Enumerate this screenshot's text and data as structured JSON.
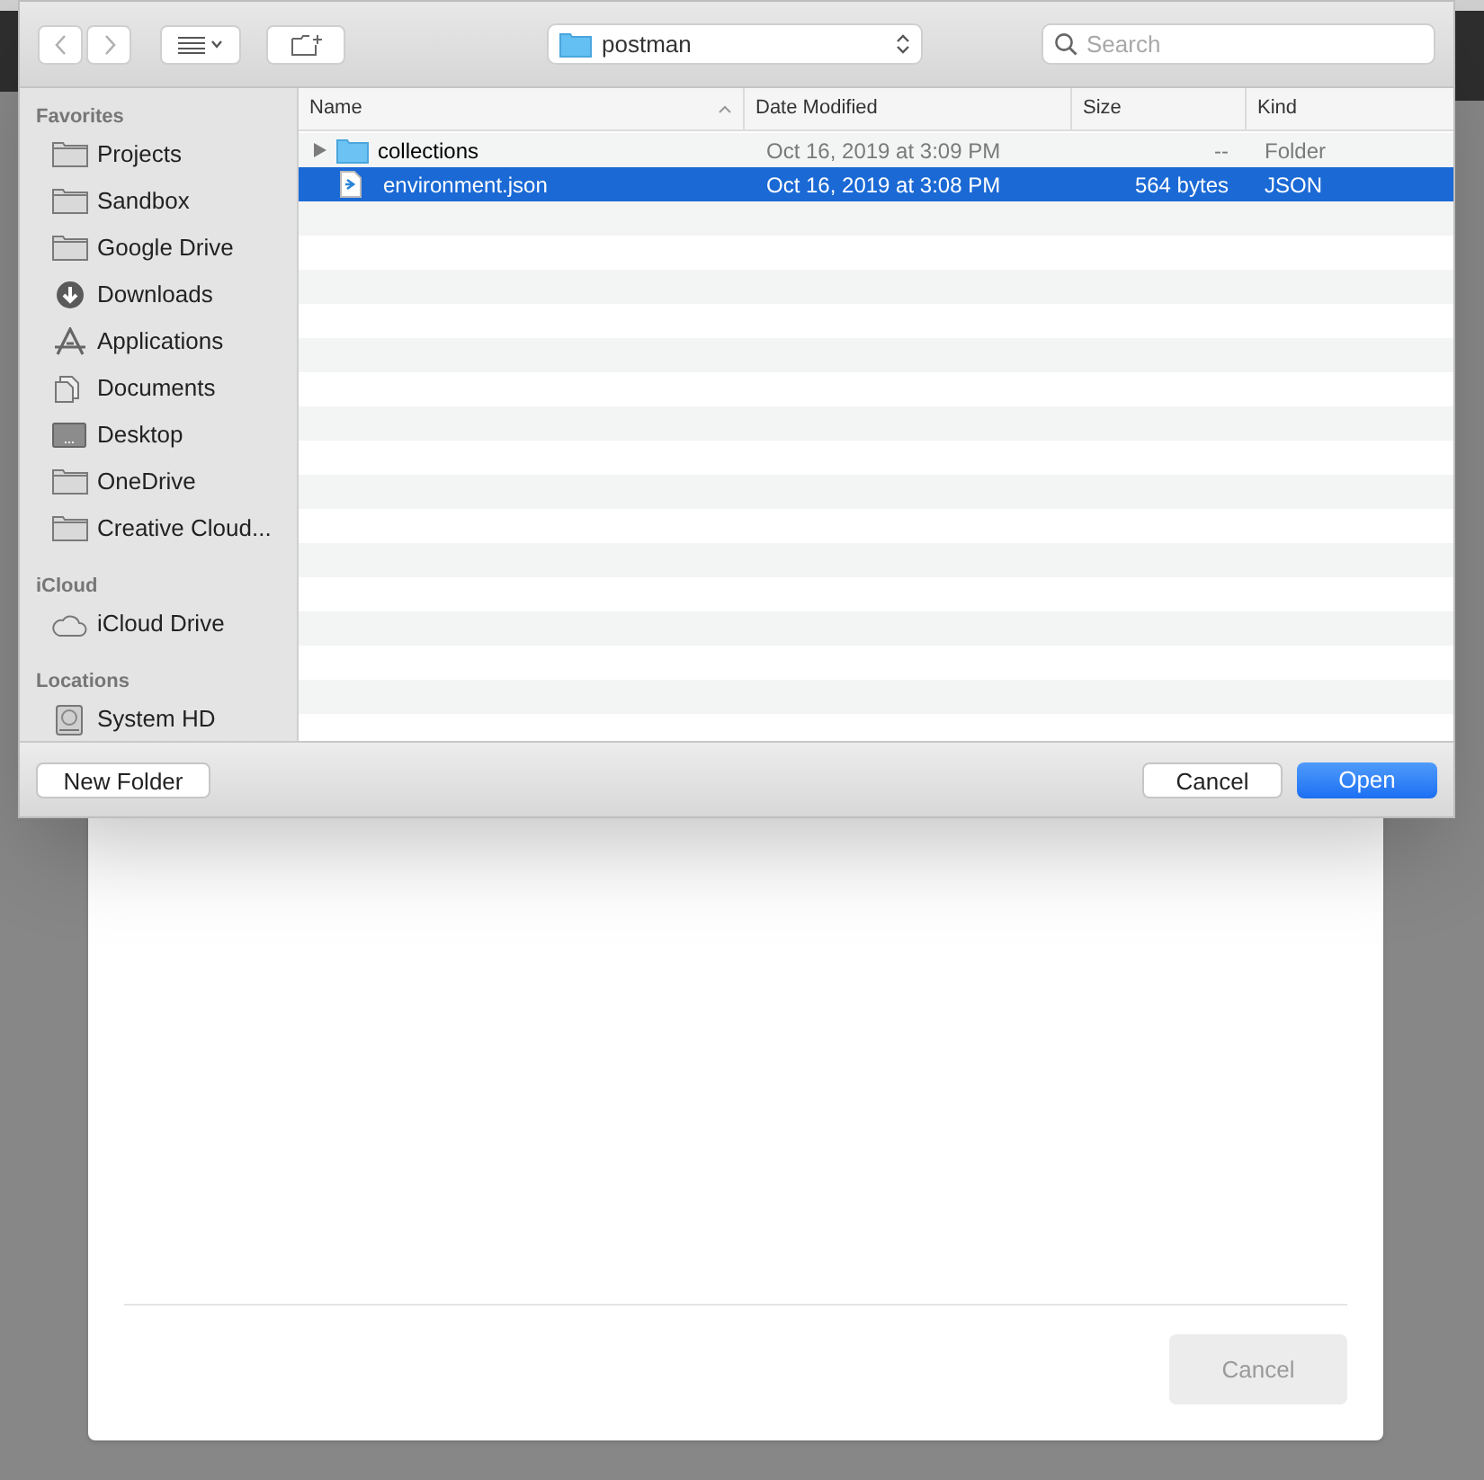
{
  "dialog": {
    "location": "postman",
    "search": {
      "placeholder": "Search"
    },
    "sidebar": [
      {
        "heading": "Favorites",
        "items": [
          {
            "label": "Projects",
            "kind": "folder"
          },
          {
            "label": "Sandbox",
            "kind": "folder"
          },
          {
            "label": "Google Drive",
            "kind": "folder"
          },
          {
            "label": "Downloads",
            "kind": "downloads"
          },
          {
            "label": "Applications",
            "kind": "apps"
          },
          {
            "label": "Documents",
            "kind": "documents"
          },
          {
            "label": "Desktop",
            "kind": "desktop"
          },
          {
            "label": "OneDrive",
            "kind": "folder"
          },
          {
            "label": "Creative Cloud...",
            "kind": "folder"
          }
        ]
      },
      {
        "heading": "iCloud",
        "items": [
          {
            "label": "iCloud Drive",
            "kind": "cloud"
          }
        ]
      },
      {
        "heading": "Locations",
        "items": [
          {
            "label": "System HD",
            "kind": "disk"
          }
        ]
      }
    ],
    "columns": [
      "Name",
      "Date Modified",
      "Size",
      "Kind"
    ],
    "rows": [
      {
        "name": "collections",
        "kind": "folder",
        "date": "Oct 16, 2019 at 3:09 PM",
        "size": "--",
        "type": "Folder",
        "selected": false
      },
      {
        "name": "environment.json",
        "kind": "file",
        "date": "Oct 16, 2019 at 3:08 PM",
        "size": "564 bytes",
        "type": "JSON",
        "selected": true
      }
    ],
    "buttons": {
      "new_folder": "New Folder",
      "cancel": "Cancel",
      "open": "Open"
    }
  },
  "background_modal": {
    "cancel": "Cancel"
  }
}
